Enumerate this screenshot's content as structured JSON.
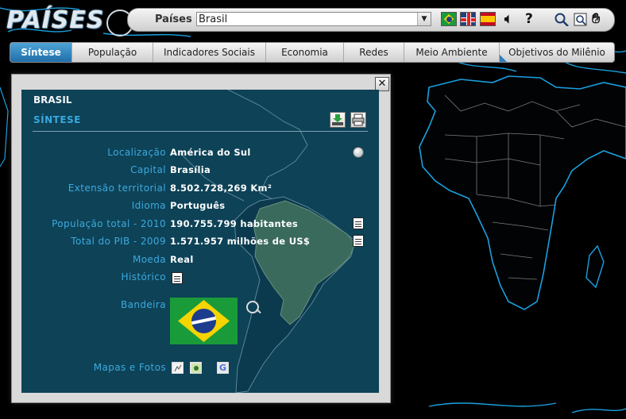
{
  "app": {
    "logo_text": "PAÍSES"
  },
  "toolbar": {
    "paises_label": "Países",
    "country_selected": "Brasil",
    "icons": [
      "flag-brazil-icon",
      "flag-uk-icon",
      "flag-spain-icon",
      "audio-icon",
      "help-icon",
      "search-icon",
      "zoom-icon",
      "pan-hand-icon"
    ]
  },
  "tabs": [
    {
      "label": "Síntese",
      "active": true
    },
    {
      "label": "População"
    },
    {
      "label": "Indicadores Sociais"
    },
    {
      "label": "Economia"
    },
    {
      "label": "Redes"
    },
    {
      "label": "Meio Ambiente"
    },
    {
      "label": "Objetivos do Milênio"
    }
  ],
  "panel": {
    "country": "BRASIL",
    "section": "SÍNTESE",
    "rows": [
      {
        "label": "Localização",
        "value": "América do Sul"
      },
      {
        "label": "Capital",
        "value": "Brasília"
      },
      {
        "label": "Extensão territorial",
        "value": "8.502.728,269 Km²"
      },
      {
        "label": "Idioma",
        "value": "Português"
      },
      {
        "label": "População total - 2010",
        "value": "190.755.799 habitantes"
      },
      {
        "label": "Total do PIB - 2009",
        "value": "1.571.957 milhões de US$"
      },
      {
        "label": "Moeda",
        "value": "Real"
      },
      {
        "label": "Histórico",
        "value": ""
      },
      {
        "label": "Bandeira",
        "value": ""
      },
      {
        "label": "Mapas e Fotos",
        "value": ""
      }
    ],
    "close_glyph": "✕",
    "google_letter": "G"
  },
  "colors": {
    "accent": "#39a8dc",
    "panel_bg": "#0d4257",
    "tab_active": "#2f7fb8"
  }
}
